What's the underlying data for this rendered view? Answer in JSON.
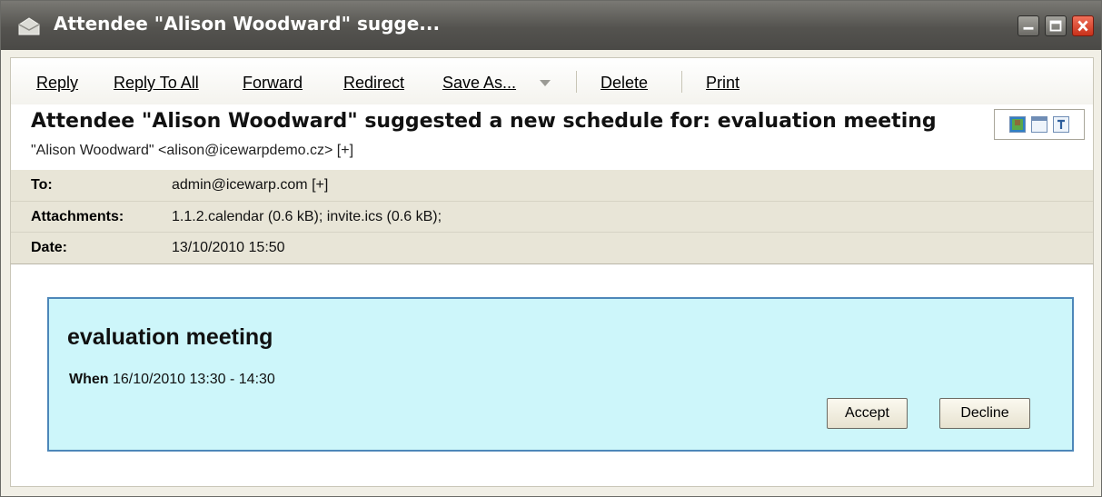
{
  "window": {
    "title": "Attendee \"Alison Woodward\" sugge...",
    "icon": "envelope-icon",
    "controls": [
      "minimize-icon",
      "maximize-icon",
      "close-icon"
    ]
  },
  "toolbar": {
    "reply": "Reply",
    "reply_all": "Reply To All",
    "forward": "Forward",
    "redirect": "Redirect",
    "save_as": "Save As...",
    "delete": "Delete",
    "print": "Print"
  },
  "message": {
    "subject": "Attendee \"Alison Woodward\" suggested a new schedule for: evaluation meeting",
    "from": "\"Alison Woodward\" <alison@icewarpdemo.cz> [+]",
    "view_icons": [
      "picture-icon",
      "html-view-icon",
      "text-view-icon"
    ],
    "to_label": "To:",
    "to_value": "admin@icewarp.com [+]",
    "attachments_label": "Attachments:",
    "attachments_value": "1.1.2.calendar (0.6 kB); invite.ics (0.6 kB);",
    "date_label": "Date:",
    "date_value": "13/10/2010 15:50"
  },
  "invitation": {
    "title": "evaluation meeting",
    "when_label": "When",
    "when_value": "16/10/2010 13:30 - 14:30",
    "accept": "Accept",
    "decline": "Decline"
  },
  "colors": {
    "title_bar": "#54534f",
    "header_bg": "#e8e5d7",
    "invite_bg": "#cdf6fa",
    "invite_border": "#4d87b9",
    "close_button": "#c8311a"
  }
}
